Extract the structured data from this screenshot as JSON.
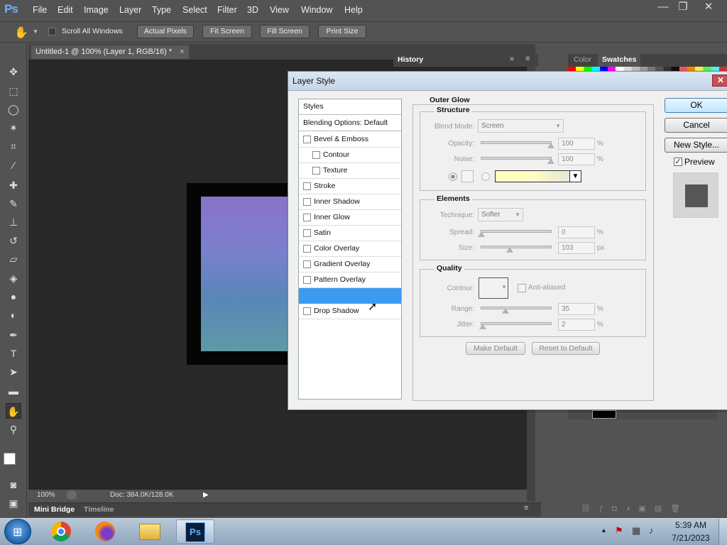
{
  "menubar": {
    "logo": "Ps",
    "items": [
      "File",
      "Edit",
      "Image",
      "Layer",
      "Type",
      "Select",
      "Filter",
      "3D",
      "View",
      "Window",
      "Help"
    ],
    "win_min": "—",
    "win_max": "❐",
    "win_close": "✕"
  },
  "options": {
    "scroll_all_label": "Scroll All Windows",
    "buttons": [
      "Actual Pixels",
      "Fit Screen",
      "Fill Screen",
      "Print Size"
    ]
  },
  "document": {
    "tab_title": "Untitled-1 @ 100% (Layer 1, RGB/16) *",
    "tab_close": "×",
    "zoom": "100%",
    "doc_info": "Doc: 384.0K/128.0K"
  },
  "panels": {
    "history_tab": "History",
    "color_tab": "Color",
    "swatches_tab": "Swatches",
    "minibridge_tab": "Mini Bridge",
    "timeline_tab": "Timeline"
  },
  "dialog": {
    "title": "Layer Style",
    "close": "✕",
    "styles_header": "Styles",
    "blending_options": "Blending Options: Default",
    "style_items": [
      {
        "label": "Bevel & Emboss",
        "indent": false
      },
      {
        "label": "Contour",
        "indent": true
      },
      {
        "label": "Texture",
        "indent": true
      },
      {
        "label": "Stroke",
        "indent": false
      },
      {
        "label": "Inner Shadow",
        "indent": false
      },
      {
        "label": "Inner Glow",
        "indent": false
      },
      {
        "label": "Satin",
        "indent": false
      },
      {
        "label": "Color Overlay",
        "indent": false
      },
      {
        "label": "Gradient Overlay",
        "indent": false
      },
      {
        "label": "Pattern Overlay",
        "indent": false
      },
      {
        "label": "",
        "indent": false
      },
      {
        "label": "Drop Shadow",
        "indent": false
      }
    ],
    "section_title": "Outer Glow",
    "structure": {
      "title": "Structure",
      "blend_mode_label": "Blend Mode:",
      "blend_mode_value": "Screen",
      "opacity_label": "Opacity:",
      "opacity_value": "100",
      "opacity_pct": 1.0,
      "noise_label": "Noise:",
      "noise_value": "100",
      "noise_pct": 1.0,
      "unit": "%",
      "glow_color": "#ffffc0"
    },
    "elements": {
      "title": "Elements",
      "technique_label": "Technique:",
      "technique_value": "Softer",
      "spread_label": "Spread:",
      "spread_value": "0",
      "spread_pct": 0.0,
      "spread_unit": "%",
      "size_label": "Size:",
      "size_value": "103",
      "size_pct": 0.41,
      "size_unit": "px"
    },
    "quality": {
      "title": "Quality",
      "contour_label": "Contour:",
      "anti_aliased_label": "Anti-aliased",
      "range_label": "Range:",
      "range_value": "35",
      "range_pct": 0.35,
      "jitter_label": "Jitter:",
      "jitter_value": "2",
      "jitter_pct": 0.02,
      "unit": "%"
    },
    "make_default": "Make Default",
    "reset_default": "Reset to Default",
    "ok": "OK",
    "cancel": "Cancel",
    "new_style": "New Style...",
    "preview_label": "Preview"
  },
  "taskbar": {
    "time": "5:39 AM",
    "date": "7/21/2023",
    "ps_label": "Ps"
  },
  "colors": {
    "selected_row": "#3d9bef",
    "ps_blue": "#6ab0ff"
  }
}
